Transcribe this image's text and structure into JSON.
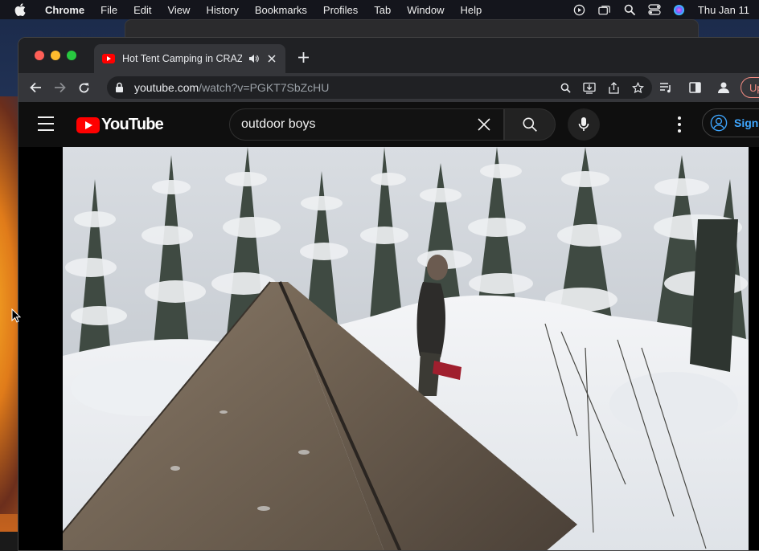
{
  "menubar": {
    "app": "Chrome",
    "items": [
      "File",
      "Edit",
      "View",
      "History",
      "Bookmarks",
      "Profiles",
      "Tab",
      "Window",
      "Help"
    ],
    "clock": "Thu Jan 11"
  },
  "browser": {
    "tab_title": "Hot Tent Camping in CRAZY",
    "url_host": "youtube.com",
    "url_path": "/watch?v=PGKT7SbZcHU",
    "update_label": "Upd"
  },
  "youtube": {
    "logo_text": "YouTube",
    "search_query": "outdoor boys",
    "signin_label": "Sign in"
  },
  "icons": {
    "apple": "apple-icon",
    "play_status": "play-circle-icon",
    "windows": "window-stack-icon",
    "search": "search-icon",
    "control_center": "control-center-icon",
    "siri": "siri-icon",
    "audio": "speaker-icon"
  },
  "colors": {
    "youtube_red": "#ff0000",
    "signin_blue": "#3ea6ff",
    "update_red": "#f28b82"
  }
}
